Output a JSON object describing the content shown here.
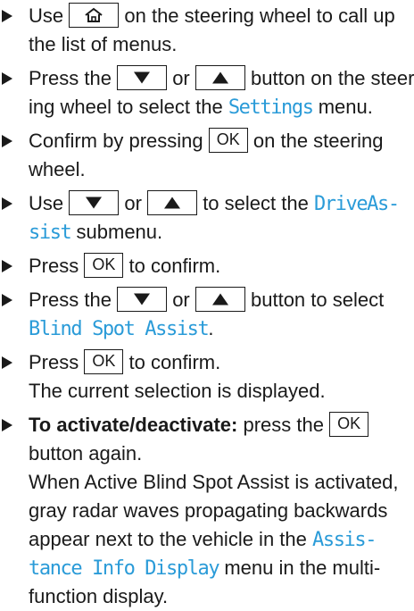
{
  "steps": [
    {
      "l1a": "Use",
      "l1b": "on the steering wheel to call up",
      "l2": "the list of menus."
    },
    {
      "l1a": "Press the",
      "l1b": "or",
      "l1c": "button on the steer-",
      "l2a": "ing wheel to select the",
      "l2disp": "Settings",
      "l2b": "menu."
    },
    {
      "l1a": "Confirm by pressing",
      "l1ok": "OK",
      "l1b": "on the steering",
      "l2": "wheel."
    },
    {
      "l1a": "Use",
      "l1b": "or",
      "l1c": "to select the",
      "l1disp": "DriveAs-",
      "l2disp": "sist",
      "l2b": "submenu."
    },
    {
      "l1a": "Press",
      "l1ok": "OK",
      "l1b": "to confirm."
    },
    {
      "l1a": "Press the",
      "l1b": "or",
      "l1c": "button to select",
      "l2disp": "Blind Spot Assist",
      "l2b": "."
    },
    {
      "l1a": "Press",
      "l1ok": "OK",
      "l1b": "to confirm.",
      "l2": "The current selection is displayed."
    },
    {
      "l1bold": "To activate/deactivate:",
      "l1a": "press the",
      "l1ok": "OK",
      "l2": "button again.",
      "l3": "When Active Blind Spot Assist is activated,",
      "l4": "gray radar waves propagating backwards",
      "l5a": "appear next to the vehicle in the",
      "l5disp": "Assis-",
      "l6disp": "tance Info Display",
      "l6b": "menu in the multi-",
      "l7": "function display."
    }
  ],
  "icons": {
    "home": "home-icon",
    "down": "down-arrow-icon",
    "up": "up-arrow-icon"
  },
  "colors": {
    "display_text": "#2a9bd8",
    "text": "#1a1a1a"
  }
}
